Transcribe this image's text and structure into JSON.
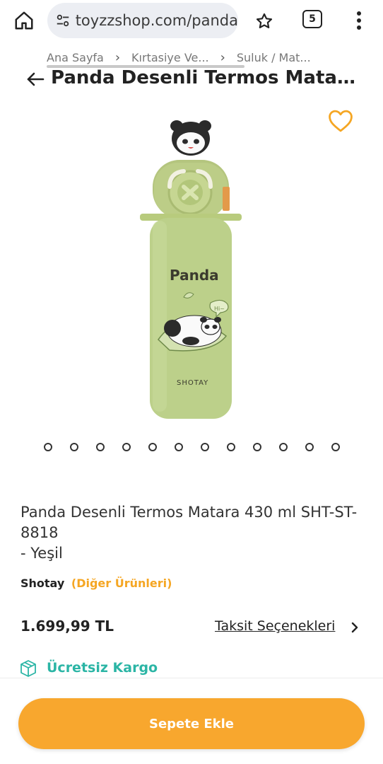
{
  "browser": {
    "url": "toyzzshop.com/panda",
    "tab_count": "5",
    "icons": {
      "home": "home-icon",
      "site_info": "tune-icon",
      "bookmark": "star-icon",
      "tabs": "tabs-icon",
      "menu": "more-vert-icon"
    }
  },
  "breadcrumb": {
    "items": [
      "Ana Sayfa",
      "Kırtasiye Ve...",
      "Suluk / Mat..."
    ],
    "separator": "›"
  },
  "header": {
    "title": "Panda Desenli Termos Matara 430 ml SHT-ST-8818 - Yeşil",
    "back_icon": "arrow-left-icon"
  },
  "product": {
    "image_alt": "Panda desenli yeşil termos matara",
    "bottle_print": {
      "word": "Panda",
      "brand": "SHOTAY",
      "speech": "Hi~"
    },
    "favorite_icon": "heart-icon",
    "gallery_dot_count": 12,
    "name_line1": "Panda Desenli Termos Matara 430 ml SHT-ST-8818",
    "name_line2": "- Yeşil",
    "brand": "Shotay",
    "other_products_label": "(Diğer Ürünleri)",
    "price": "1.699,99 TL",
    "installment_label": "Taksit Seçenekleri",
    "shipping_label": "Ücretsiz Kargo",
    "shipping_icon": "package-icon"
  },
  "cart": {
    "button_label": "Sepete Ekle"
  },
  "colors": {
    "accent": "#f8a72e",
    "brand_link": "#f5a623",
    "shipping": "#2bb5a5",
    "bottle": "#bcd08a"
  }
}
